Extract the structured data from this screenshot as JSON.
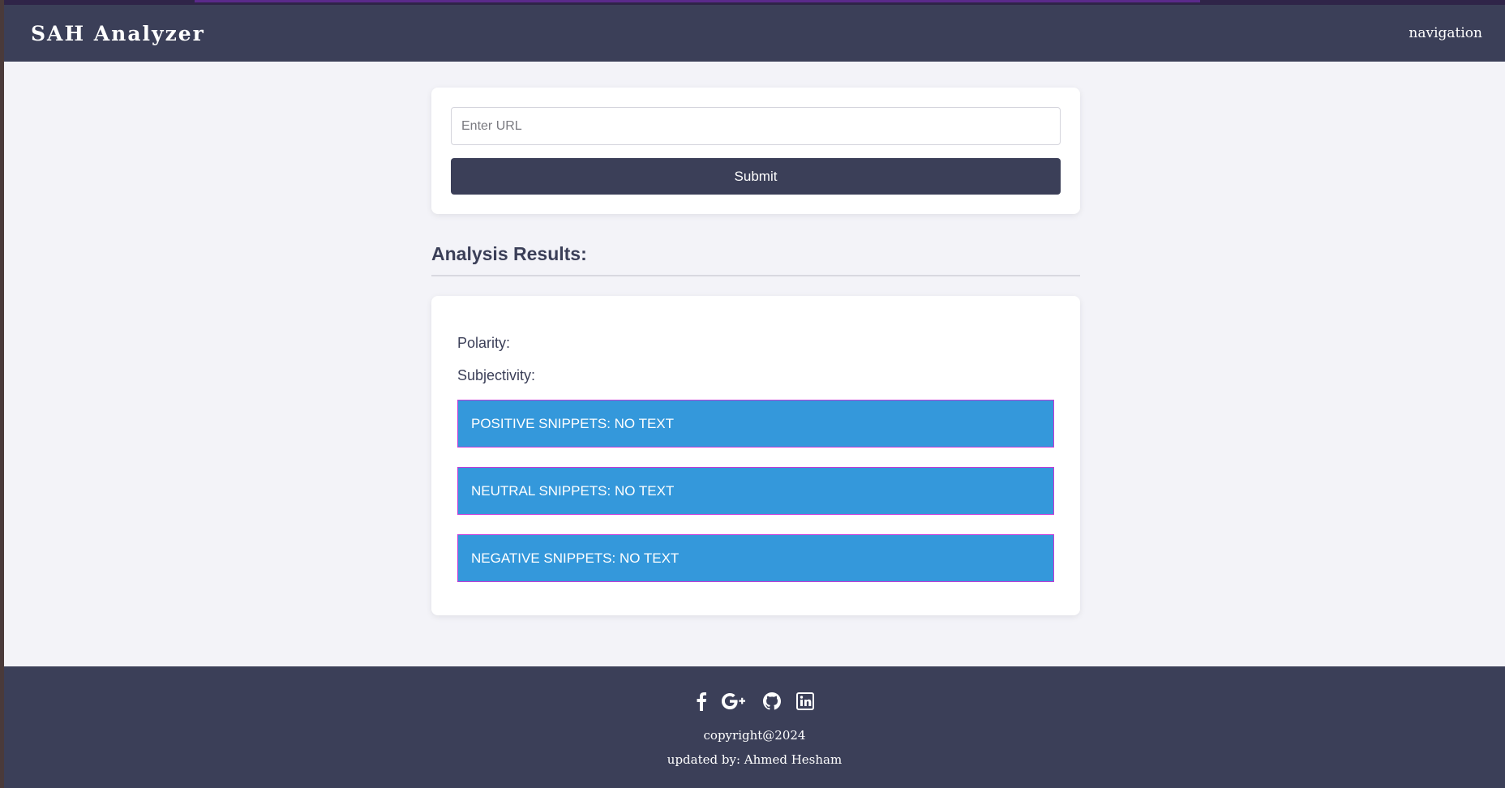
{
  "header": {
    "brand": "SAH Analyzer",
    "nav_label": "navigation"
  },
  "form": {
    "url_placeholder": "Enter URL",
    "url_value": "",
    "submit_label": "Submit"
  },
  "results": {
    "heading": "Analysis Results:",
    "polarity_label": "Polarity:",
    "subjectivity_label": "Subjectivity:",
    "snippets": [
      {
        "text": "POSITIVE SNIPPETS: NO TEXT"
      },
      {
        "text": "NEUTRAL SNIPPETS: NO TEXT"
      },
      {
        "text": "NEGATIVE SNIPPETS: NO TEXT"
      }
    ]
  },
  "footer": {
    "icons": [
      "facebook-icon",
      "google-plus-icon",
      "github-icon",
      "linkedin-icon"
    ],
    "copyright": "copyright@2024",
    "updated_by": "updated by: Ahmed Hesham"
  },
  "colors": {
    "primary": "#3b3f58",
    "snippet_bg": "#3498db",
    "snippet_border": "#c43ad8",
    "page_bg": "#f3f3f8"
  }
}
